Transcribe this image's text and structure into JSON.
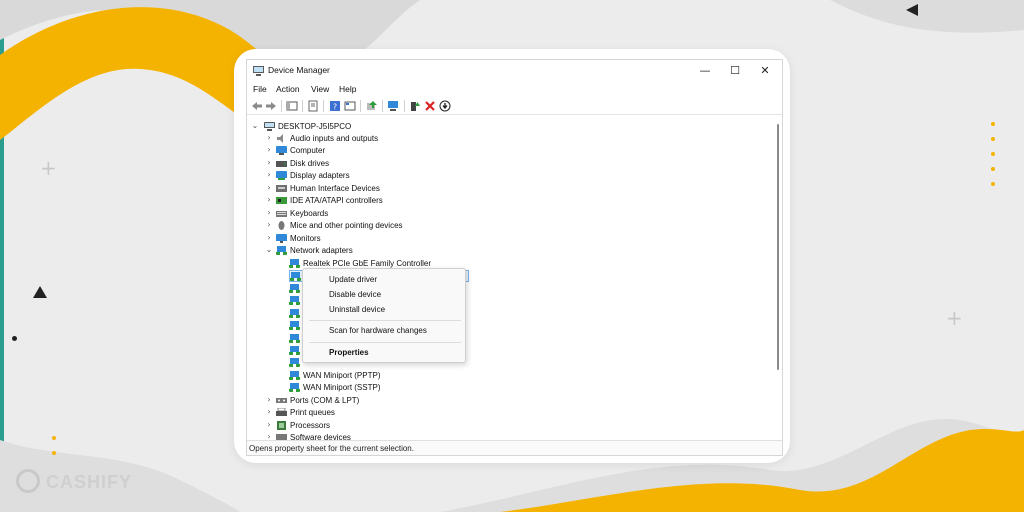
{
  "window": {
    "title": "Device Manager",
    "controls": {
      "minimize": "—",
      "maximize": "☐",
      "close": "✕"
    }
  },
  "menubar": [
    "File",
    "Action",
    "View",
    "Help"
  ],
  "toolbar": {
    "buttons": [
      "back-icon",
      "forward-icon",
      "show-hide-console-tree-icon",
      "properties-icon",
      "help-icon",
      "console-view-icon",
      "update-driver-icon",
      "scan-hardware-icon",
      "enable-device-icon",
      "uninstall-icon",
      "disable-icon"
    ]
  },
  "tree": {
    "root": "DESKTOP-J5I5PCO",
    "categories": [
      {
        "label": "Audio inputs and outputs",
        "icon": "speaker-icon",
        "color": "#8a8a8a"
      },
      {
        "label": "Computer",
        "icon": "computer-icon",
        "color": "#2f88d8"
      },
      {
        "label": "Disk drives",
        "icon": "disk-icon",
        "color": "#555555"
      },
      {
        "label": "Display adapters",
        "icon": "display-adapter-icon",
        "color": "#2f88d8"
      },
      {
        "label": "Human Interface Devices",
        "icon": "hid-icon",
        "color": "#6f6f6f"
      },
      {
        "label": "IDE ATA/ATAPI controllers",
        "icon": "ide-icon",
        "color": "#3a9a3a"
      },
      {
        "label": "Keyboards",
        "icon": "keyboard-icon",
        "color": "#777777"
      },
      {
        "label": "Mice and other pointing devices",
        "icon": "mouse-icon",
        "color": "#777777"
      },
      {
        "label": "Monitors",
        "icon": "monitor-icon",
        "color": "#2f88d8"
      },
      {
        "label": "Network adapters",
        "icon": "network-icon",
        "color": "#2f88d8"
      }
    ],
    "network_children": [
      "Realtek PCIe GbE Family Controller",
      "",
      "",
      "",
      "",
      "",
      "",
      "",
      "",
      "WAN Miniport (PPTP)",
      "WAN Miniport (SSTP)"
    ],
    "after_categories": [
      {
        "label": "Ports (COM & LPT)",
        "icon": "port-icon",
        "color": "#777777"
      },
      {
        "label": "Print queues",
        "icon": "printer-icon",
        "color": "#555555"
      },
      {
        "label": "Processors",
        "icon": "processor-icon",
        "color": "#3a7a3a"
      },
      {
        "label": "Software devices",
        "icon": "software-device-icon",
        "color": "#777777"
      }
    ]
  },
  "context_menu": {
    "update": "Update driver",
    "disable": "Disable device",
    "uninstall": "Uninstall device",
    "scan": "Scan for hardware changes",
    "properties": "Properties"
  },
  "statusbar": {
    "text": "Opens property sheet for the current selection."
  },
  "brand": {
    "logo_text": "CASHIFY"
  },
  "colors": {
    "accent_yellow": "#f5b301",
    "network_blue": "#2f88d8"
  }
}
